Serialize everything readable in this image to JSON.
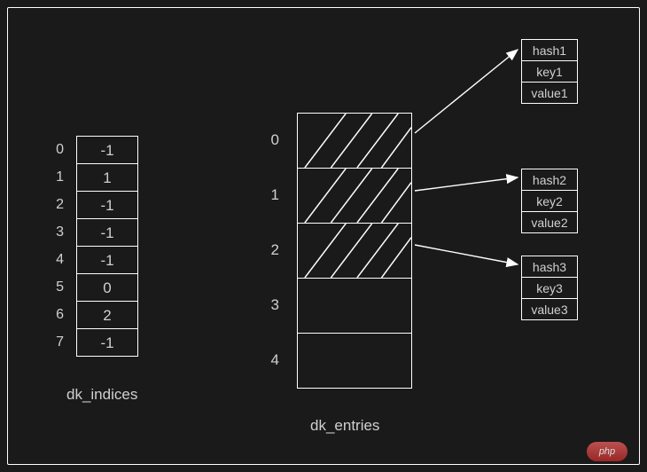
{
  "indices": {
    "label": "dk_indices",
    "rows": [
      {
        "i": "0",
        "v": "-1"
      },
      {
        "i": "1",
        "v": "1"
      },
      {
        "i": "2",
        "v": "-1"
      },
      {
        "i": "3",
        "v": "-1"
      },
      {
        "i": "4",
        "v": "-1"
      },
      {
        "i": "5",
        "v": "0"
      },
      {
        "i": "6",
        "v": "2"
      },
      {
        "i": "7",
        "v": "-1"
      }
    ]
  },
  "entries": {
    "label": "dk_entries",
    "rows": [
      {
        "i": "0",
        "filled": true
      },
      {
        "i": "1",
        "filled": true
      },
      {
        "i": "2",
        "filled": true
      },
      {
        "i": "3",
        "filled": false
      },
      {
        "i": "4",
        "filled": false
      }
    ],
    "details": [
      {
        "hash": "hash1",
        "key": "key1",
        "value": "value1"
      },
      {
        "hash": "hash2",
        "key": "key2",
        "value": "value2"
      },
      {
        "hash": "hash3",
        "key": "key3",
        "value": "value3"
      }
    ]
  },
  "watermark": "php"
}
